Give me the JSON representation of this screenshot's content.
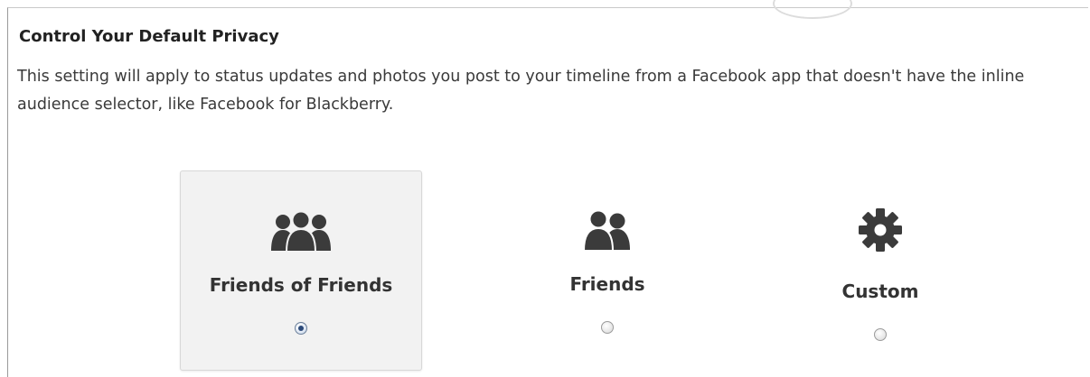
{
  "privacy": {
    "title": "Control Your Default Privacy",
    "description": "This setting will apply to status updates and photos you post to your timeline from a Facebook app that doesn't have the inline audience selector, like Facebook for Blackberry.",
    "options": [
      {
        "label": "Friends of Friends",
        "icon": "friends-of-friends-icon",
        "selected": true
      },
      {
        "label": "Friends",
        "icon": "friends-icon",
        "selected": false
      },
      {
        "label": "Custom",
        "icon": "gear-icon",
        "selected": false
      }
    ]
  },
  "colors": {
    "icon": "#3b3b3b",
    "selected_bg": "#f2f2f2",
    "radio_checked": "#2c4a7a"
  }
}
